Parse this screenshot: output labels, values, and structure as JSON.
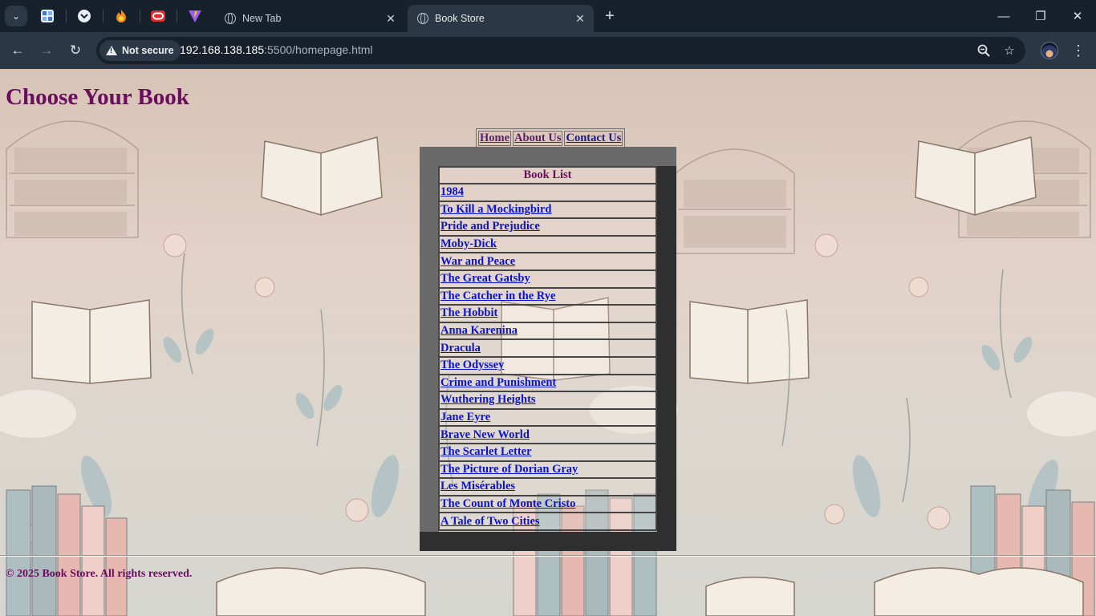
{
  "browser": {
    "tabs": [
      {
        "title": "New Tab",
        "active": false
      },
      {
        "title": "Book Store",
        "active": true
      }
    ],
    "address": {
      "security_label": "Not secure",
      "host": "192.168.138.185",
      "path": ":5500/homepage.html"
    },
    "window_controls": {
      "minimize": "—",
      "restore": "❐",
      "close": "✕"
    }
  },
  "page": {
    "heading": "Choose Your Book",
    "nav": [
      "Home",
      "About Us",
      "Contact Us"
    ],
    "book_list": {
      "header": "Book List",
      "books": [
        "1984",
        "To Kill a Mockingbird",
        "Pride and Prejudice",
        "Moby-Dick",
        "War and Peace",
        "The Great Gatsby",
        "The Catcher in the Rye",
        "The Hobbit",
        "Anna Karenina",
        "Dracula",
        "The Odyssey",
        "Crime and Punishment",
        "Wuthering Heights",
        "Jane Eyre",
        "Brave New World",
        "The Scarlet Letter",
        "The Picture of Dorian Gray",
        "Les Misérables",
        "The Count of Monte Cristo",
        "A Tale of Two Cities"
      ]
    },
    "footer": "© 2025 Book Store. All rights reserved."
  },
  "colors": {
    "heading": "#6b0d5e",
    "link": "#0b14c8",
    "frame_dark": "#2f2f2f",
    "frame_light": "#6a6a6a"
  }
}
